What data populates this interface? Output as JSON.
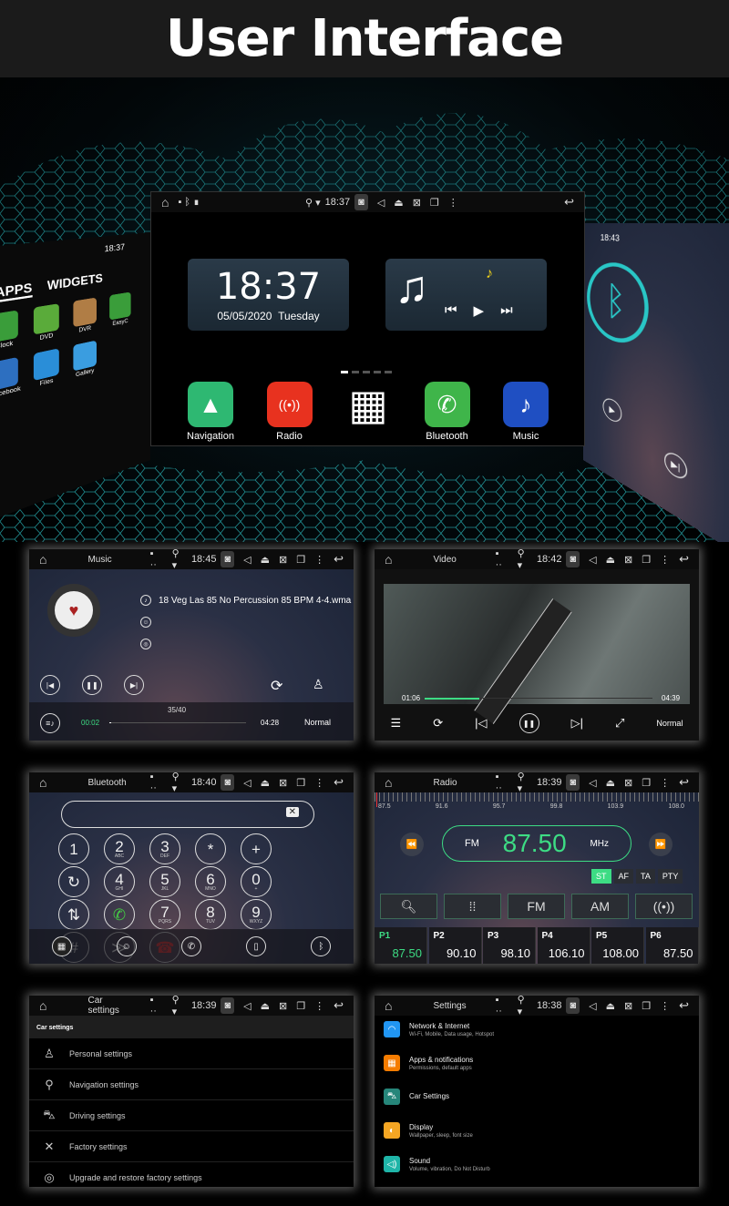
{
  "header": {
    "title": "User Interface"
  },
  "hero": {
    "status_time": "18:37",
    "clock": {
      "time": "18:37",
      "date": "05/05/2020",
      "day": "Tuesday"
    },
    "dock": [
      {
        "label": "Navigation",
        "icon": "navigation-icon",
        "color": "#2eb872"
      },
      {
        "label": "Radio",
        "icon": "radio-icon",
        "color": "#e8321f"
      },
      {
        "label": "",
        "icon": "apps-grid-icon",
        "color": "#000000"
      },
      {
        "label": "Bluetooth",
        "icon": "bluetooth-phone-icon",
        "color": "#3fb54a"
      },
      {
        "label": "Music",
        "icon": "music-note-icon",
        "color": "#1f4fc2"
      }
    ],
    "left_panel": {
      "time": "18:37",
      "tabs": [
        "APPS",
        "WIDGETS"
      ],
      "apps": [
        "Clock",
        "DVD",
        "DVR",
        "EasyC",
        "Facebook",
        "Files",
        "Gallery"
      ]
    },
    "right_panel": {
      "time": "18:43"
    }
  },
  "music": {
    "title": "Music",
    "time": "18:45",
    "track": "18 Veg Las 85 No Percussion 85 BPM 4-4.wma",
    "count": "35/40",
    "elapsed": "00:02",
    "duration": "04:28",
    "mode": "Normal",
    "progress": 0.01
  },
  "video": {
    "title": "Video",
    "time": "18:42",
    "elapsed": "01:06",
    "duration": "04:39",
    "mode": "Normal",
    "progress": 0.24
  },
  "bluetooth": {
    "title": "Bluetooth",
    "time": "18:40",
    "keys": [
      [
        "1",
        ""
      ],
      [
        "2",
        "ABC"
      ],
      [
        "3",
        "DEF"
      ],
      [
        "*",
        ""
      ],
      [
        "+",
        ""
      ],
      [
        "↻",
        ""
      ],
      [
        "4",
        "GHI"
      ],
      [
        "5",
        "JKL"
      ],
      [
        "6",
        "MNO"
      ],
      [
        "0",
        "+"
      ],
      [
        "⇅",
        ""
      ],
      [
        "✆",
        ""
      ],
      [
        "7",
        "PQRS"
      ],
      [
        "8",
        "TUV"
      ],
      [
        "9",
        "WXYZ"
      ],
      [
        "#",
        ""
      ],
      [
        "≫",
        ""
      ],
      [
        "☎",
        ""
      ]
    ]
  },
  "radio": {
    "title": "Radio",
    "time": "18:39",
    "scale": [
      "87.5",
      "91.6",
      "95.7",
      "99.8",
      "103.9",
      "108.0"
    ],
    "band": "FM",
    "freq": "87.50",
    "unit": "MHz",
    "flags": [
      "ST",
      "AF",
      "TA",
      "PTY"
    ],
    "buttons": [
      "FM",
      "AM"
    ],
    "presets": [
      {
        "p": "P1",
        "v": "87.50"
      },
      {
        "p": "P2",
        "v": "90.10"
      },
      {
        "p": "P3",
        "v": "98.10"
      },
      {
        "p": "P4",
        "v": "106.10"
      },
      {
        "p": "P5",
        "v": "108.00"
      },
      {
        "p": "P6",
        "v": "87.50"
      }
    ],
    "accent": "#3ddc84"
  },
  "car": {
    "title": "Car settings",
    "time": "18:39",
    "heading": "Car settings",
    "items": [
      {
        "label": "Personal settings",
        "icon": "person-icon"
      },
      {
        "label": "Navigation settings",
        "icon": "location-icon"
      },
      {
        "label": "Driving settings",
        "icon": "car-icon"
      },
      {
        "label": "Factory settings",
        "icon": "tools-icon"
      },
      {
        "label": "Upgrade and restore factory settings",
        "icon": "upgrade-icon"
      }
    ]
  },
  "settings": {
    "title": "Settings",
    "time": "18:38",
    "items": [
      {
        "title": "Network & Internet",
        "sub": "Wi-Fi, Mobile, Data usage, Hotspot",
        "color": "#2196f3",
        "icon": "wifi-icon"
      },
      {
        "title": "Apps & notifications",
        "sub": "Permissions, default apps",
        "color": "#f57c00",
        "icon": "apps-icon"
      },
      {
        "title": "Car Settings",
        "sub": "",
        "color": "#26867a",
        "icon": "car-icon"
      },
      {
        "title": "Display",
        "sub": "Wallpaper, sleep, font size",
        "color": "#f5a623",
        "icon": "display-icon"
      },
      {
        "title": "Sound",
        "sub": "Volume, vibration, Do Not Disturb",
        "color": "#1fb5a8",
        "icon": "sound-icon"
      }
    ]
  }
}
